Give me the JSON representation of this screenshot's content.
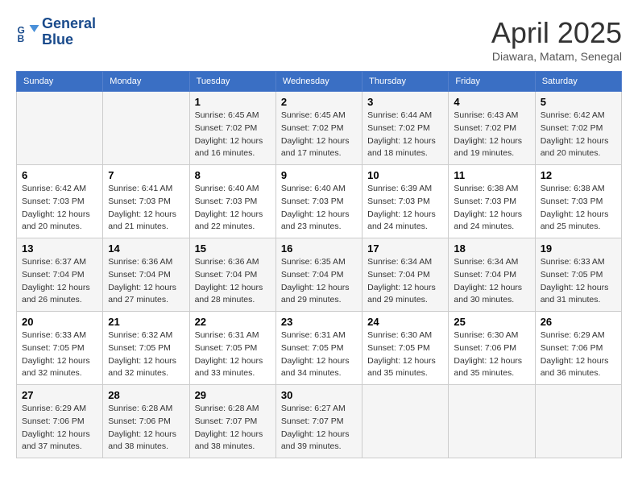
{
  "header": {
    "logo_line1": "General",
    "logo_line2": "Blue",
    "month_year": "April 2025",
    "location": "Diawara, Matam, Senegal"
  },
  "weekdays": [
    "Sunday",
    "Monday",
    "Tuesday",
    "Wednesday",
    "Thursday",
    "Friday",
    "Saturday"
  ],
  "weeks": [
    [
      {
        "day": "",
        "info": ""
      },
      {
        "day": "",
        "info": ""
      },
      {
        "day": "1",
        "info": "Sunrise: 6:45 AM\nSunset: 7:02 PM\nDaylight: 12 hours and 16 minutes."
      },
      {
        "day": "2",
        "info": "Sunrise: 6:45 AM\nSunset: 7:02 PM\nDaylight: 12 hours and 17 minutes."
      },
      {
        "day": "3",
        "info": "Sunrise: 6:44 AM\nSunset: 7:02 PM\nDaylight: 12 hours and 18 minutes."
      },
      {
        "day": "4",
        "info": "Sunrise: 6:43 AM\nSunset: 7:02 PM\nDaylight: 12 hours and 19 minutes."
      },
      {
        "day": "5",
        "info": "Sunrise: 6:42 AM\nSunset: 7:02 PM\nDaylight: 12 hours and 20 minutes."
      }
    ],
    [
      {
        "day": "6",
        "info": "Sunrise: 6:42 AM\nSunset: 7:03 PM\nDaylight: 12 hours and 20 minutes."
      },
      {
        "day": "7",
        "info": "Sunrise: 6:41 AM\nSunset: 7:03 PM\nDaylight: 12 hours and 21 minutes."
      },
      {
        "day": "8",
        "info": "Sunrise: 6:40 AM\nSunset: 7:03 PM\nDaylight: 12 hours and 22 minutes."
      },
      {
        "day": "9",
        "info": "Sunrise: 6:40 AM\nSunset: 7:03 PM\nDaylight: 12 hours and 23 minutes."
      },
      {
        "day": "10",
        "info": "Sunrise: 6:39 AM\nSunset: 7:03 PM\nDaylight: 12 hours and 24 minutes."
      },
      {
        "day": "11",
        "info": "Sunrise: 6:38 AM\nSunset: 7:03 PM\nDaylight: 12 hours and 24 minutes."
      },
      {
        "day": "12",
        "info": "Sunrise: 6:38 AM\nSunset: 7:03 PM\nDaylight: 12 hours and 25 minutes."
      }
    ],
    [
      {
        "day": "13",
        "info": "Sunrise: 6:37 AM\nSunset: 7:04 PM\nDaylight: 12 hours and 26 minutes."
      },
      {
        "day": "14",
        "info": "Sunrise: 6:36 AM\nSunset: 7:04 PM\nDaylight: 12 hours and 27 minutes."
      },
      {
        "day": "15",
        "info": "Sunrise: 6:36 AM\nSunset: 7:04 PM\nDaylight: 12 hours and 28 minutes."
      },
      {
        "day": "16",
        "info": "Sunrise: 6:35 AM\nSunset: 7:04 PM\nDaylight: 12 hours and 29 minutes."
      },
      {
        "day": "17",
        "info": "Sunrise: 6:34 AM\nSunset: 7:04 PM\nDaylight: 12 hours and 29 minutes."
      },
      {
        "day": "18",
        "info": "Sunrise: 6:34 AM\nSunset: 7:04 PM\nDaylight: 12 hours and 30 minutes."
      },
      {
        "day": "19",
        "info": "Sunrise: 6:33 AM\nSunset: 7:05 PM\nDaylight: 12 hours and 31 minutes."
      }
    ],
    [
      {
        "day": "20",
        "info": "Sunrise: 6:33 AM\nSunset: 7:05 PM\nDaylight: 12 hours and 32 minutes."
      },
      {
        "day": "21",
        "info": "Sunrise: 6:32 AM\nSunset: 7:05 PM\nDaylight: 12 hours and 32 minutes."
      },
      {
        "day": "22",
        "info": "Sunrise: 6:31 AM\nSunset: 7:05 PM\nDaylight: 12 hours and 33 minutes."
      },
      {
        "day": "23",
        "info": "Sunrise: 6:31 AM\nSunset: 7:05 PM\nDaylight: 12 hours and 34 minutes."
      },
      {
        "day": "24",
        "info": "Sunrise: 6:30 AM\nSunset: 7:05 PM\nDaylight: 12 hours and 35 minutes."
      },
      {
        "day": "25",
        "info": "Sunrise: 6:30 AM\nSunset: 7:06 PM\nDaylight: 12 hours and 35 minutes."
      },
      {
        "day": "26",
        "info": "Sunrise: 6:29 AM\nSunset: 7:06 PM\nDaylight: 12 hours and 36 minutes."
      }
    ],
    [
      {
        "day": "27",
        "info": "Sunrise: 6:29 AM\nSunset: 7:06 PM\nDaylight: 12 hours and 37 minutes."
      },
      {
        "day": "28",
        "info": "Sunrise: 6:28 AM\nSunset: 7:06 PM\nDaylight: 12 hours and 38 minutes."
      },
      {
        "day": "29",
        "info": "Sunrise: 6:28 AM\nSunset: 7:07 PM\nDaylight: 12 hours and 38 minutes."
      },
      {
        "day": "30",
        "info": "Sunrise: 6:27 AM\nSunset: 7:07 PM\nDaylight: 12 hours and 39 minutes."
      },
      {
        "day": "",
        "info": ""
      },
      {
        "day": "",
        "info": ""
      },
      {
        "day": "",
        "info": ""
      }
    ]
  ]
}
